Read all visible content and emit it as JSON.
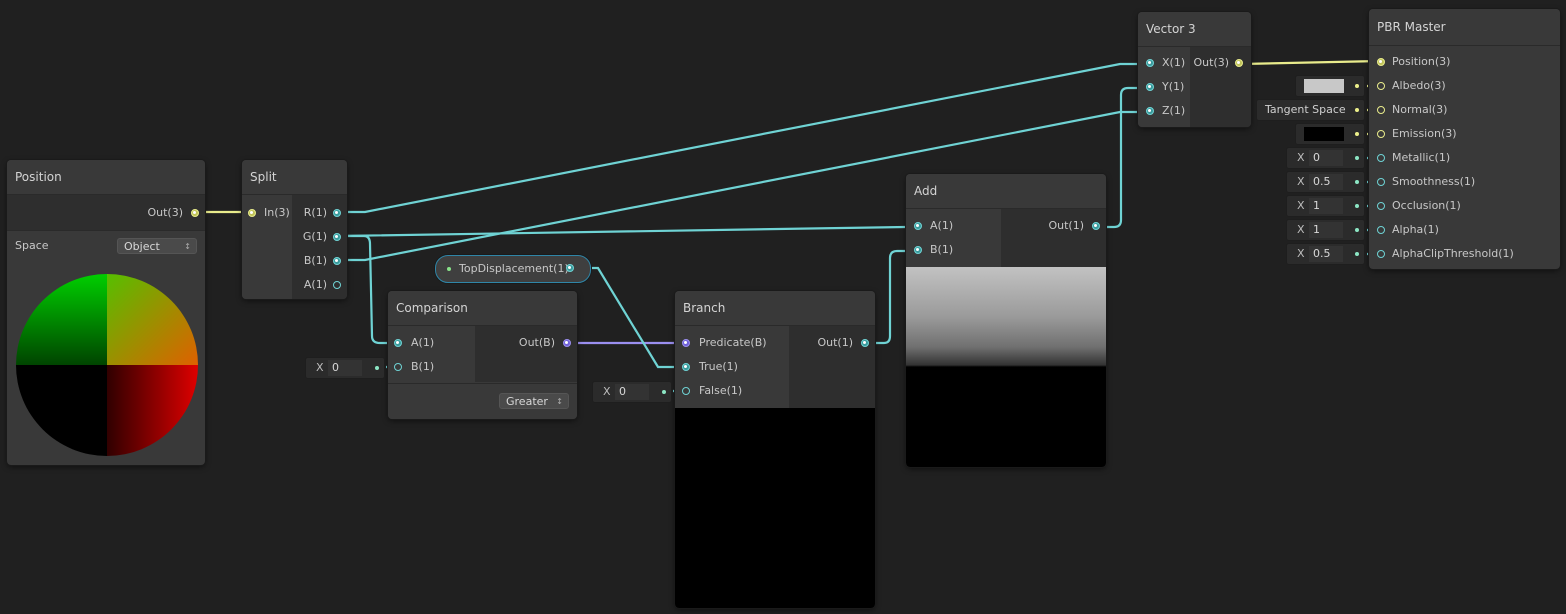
{
  "nodes": {
    "position": {
      "title": "Position",
      "output": "Out(3)",
      "space_label": "Space",
      "space_value": "Object"
    },
    "split": {
      "title": "Split",
      "input": "In(3)",
      "outputs": [
        "R(1)",
        "G(1)",
        "B(1)",
        "A(1)"
      ]
    },
    "comparison": {
      "title": "Comparison",
      "inputs": [
        "A(1)",
        "B(1)"
      ],
      "output": "Out(B)",
      "b_default": {
        "axis": "X",
        "value": "0"
      },
      "mode": "Greater"
    },
    "top_displacement": {
      "label": "TopDisplacement(1)"
    },
    "branch": {
      "title": "Branch",
      "inputs": [
        "Predicate(B)",
        "True(1)",
        "False(1)"
      ],
      "output": "Out(1)",
      "false_default": {
        "axis": "X",
        "value": "0"
      }
    },
    "add": {
      "title": "Add",
      "inputs": [
        "A(1)",
        "B(1)"
      ],
      "output": "Out(1)"
    },
    "vector3": {
      "title": "Vector 3",
      "inputs": [
        "X(1)",
        "Y(1)",
        "Z(1)"
      ],
      "output": "Out(3)"
    },
    "pbr_master": {
      "title": "PBR Master",
      "inputs": [
        "Position(3)",
        "Albedo(3)",
        "Normal(3)",
        "Emission(3)",
        "Metallic(1)",
        "Smoothness(1)",
        "Occlusion(1)",
        "Alpha(1)",
        "AlphaClipThreshold(1)"
      ],
      "defaults": {
        "albedo_color": "#c8c8c8",
        "normal_space": "Tangent Space",
        "emission_color": "#000000",
        "metallic": {
          "axis": "X",
          "value": "0"
        },
        "smoothness": {
          "axis": "X",
          "value": "0.5"
        },
        "occlusion": {
          "axis": "X",
          "value": "1"
        },
        "alpha": {
          "axis": "X",
          "value": "1"
        },
        "alpha_clip": {
          "axis": "X",
          "value": "0.5"
        }
      }
    }
  },
  "colors": {
    "background": "#202020",
    "node": "#393939",
    "wire_vector1": "#6fd3d4",
    "wire_vector3": "#e9ec8c",
    "wire_boolean": "#9b8ff0"
  }
}
